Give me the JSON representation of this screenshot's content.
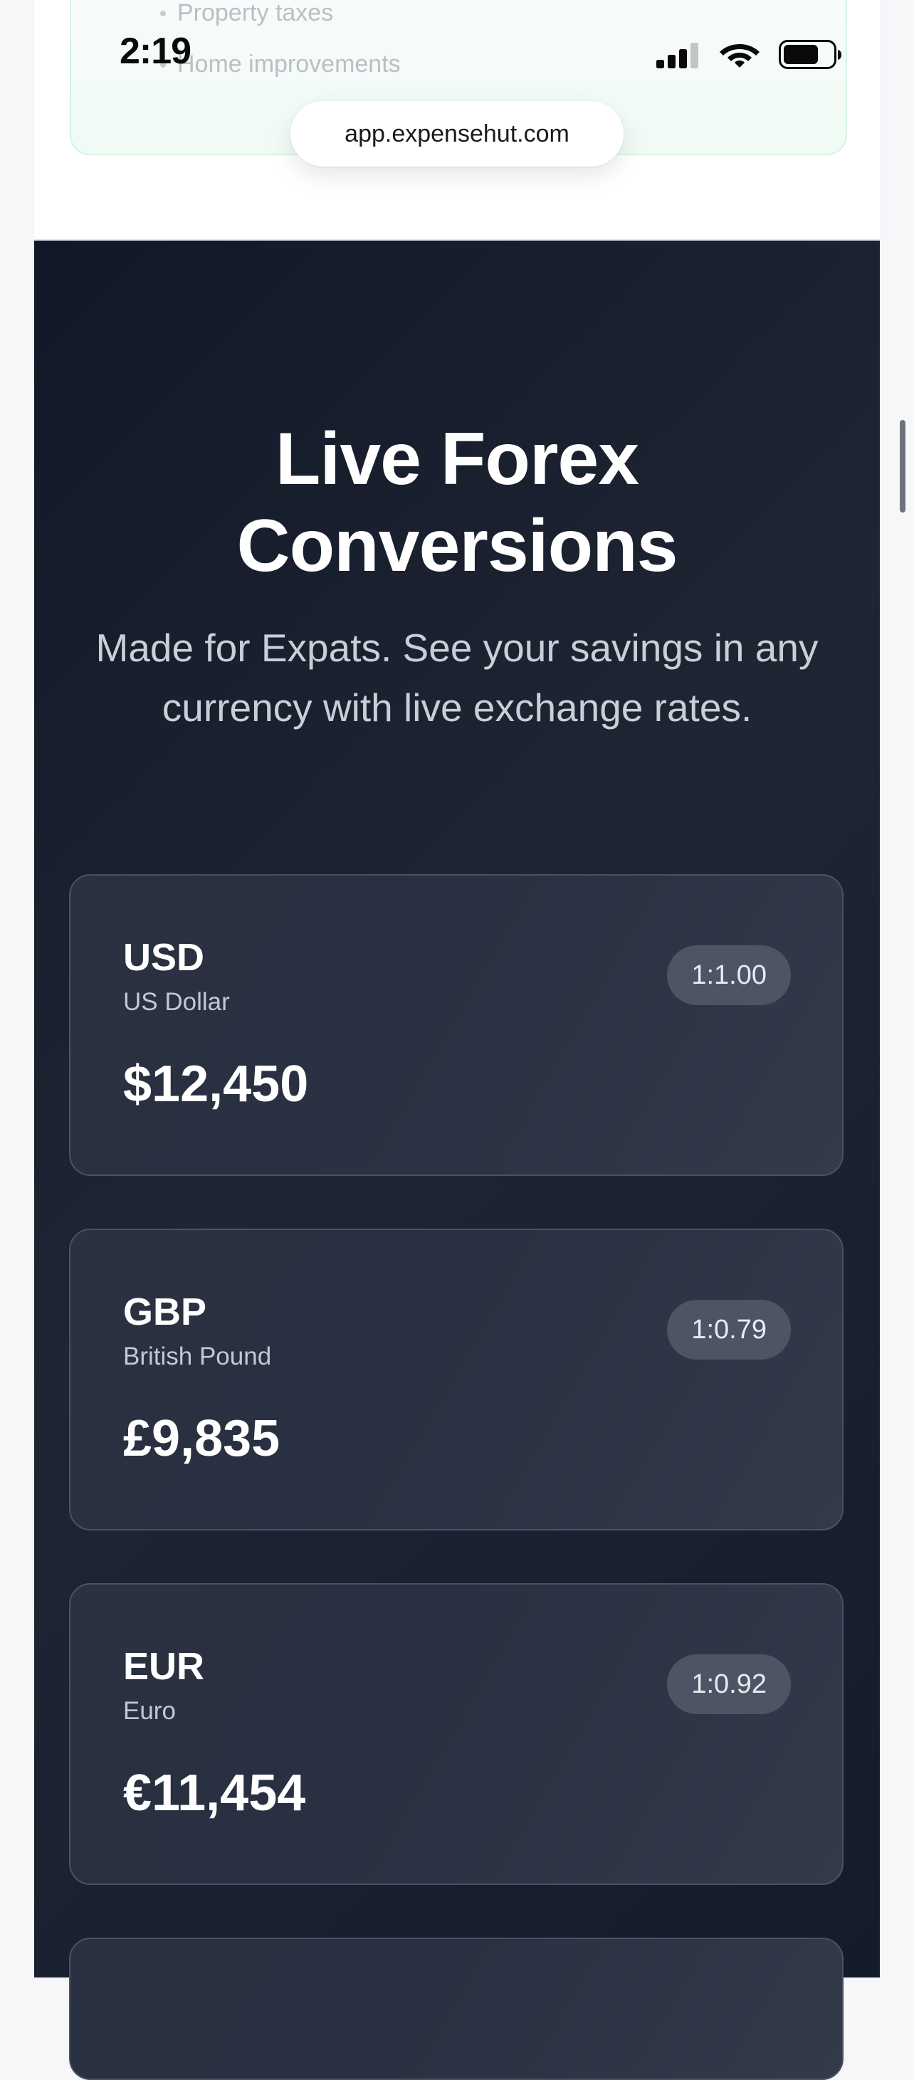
{
  "status_bar": {
    "time": "2:19",
    "icons": [
      "cellular-signal-icon",
      "wifi-icon",
      "battery-icon"
    ]
  },
  "browser": {
    "url": "app.expensehut.com"
  },
  "previous_section": {
    "items": [
      "Property taxes",
      "Home improvements"
    ]
  },
  "forex": {
    "title_line1": "Live Forex",
    "title_line2": "Conversions",
    "subtitle": "Made for Expats. See your savings in any currency with live exchange rates.",
    "currencies": [
      {
        "code": "USD",
        "name": "US Dollar",
        "amount": "$12,450",
        "rate": "1:1.00"
      },
      {
        "code": "GBP",
        "name": "British Pound",
        "amount": "£9,835",
        "rate": "1:0.79"
      },
      {
        "code": "EUR",
        "name": "Euro",
        "amount": "€11,454",
        "rate": "1:0.92"
      }
    ]
  },
  "colors": {
    "dark_bg": "#111827",
    "card_bg": "#2b3140",
    "badge_bg": "#4d5564",
    "accent_green_border": "#d7f3e3"
  }
}
